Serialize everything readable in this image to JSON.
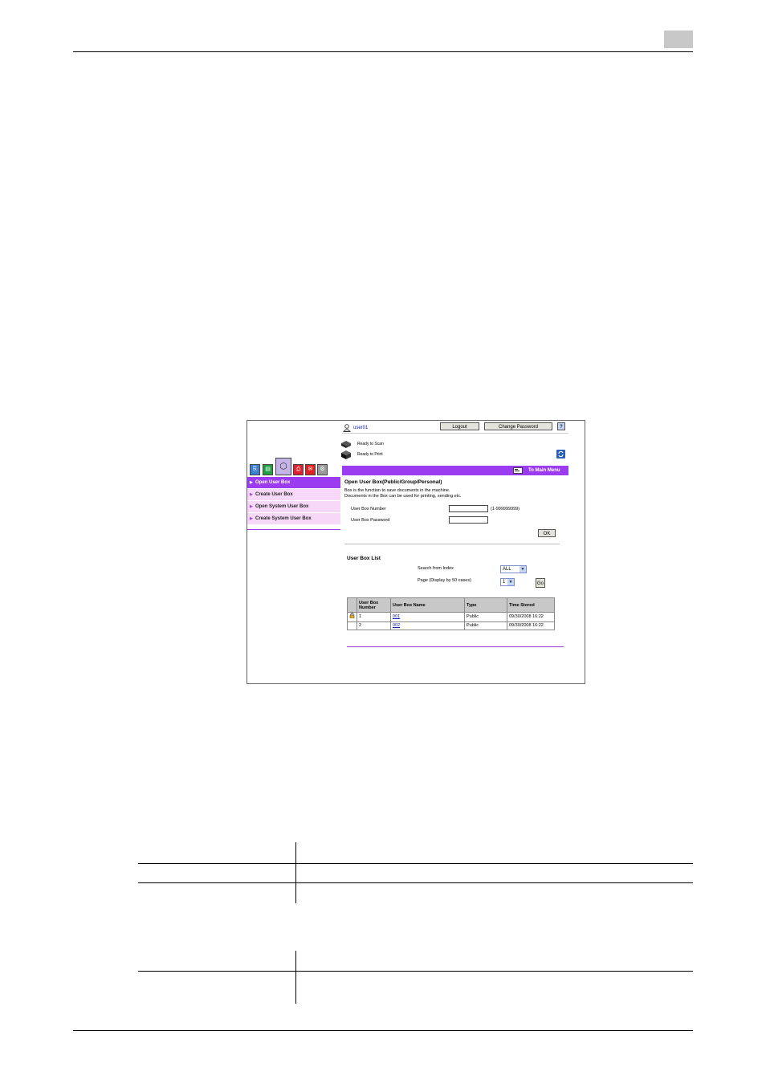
{
  "user": {
    "name": "user01"
  },
  "buttons": {
    "logout": "Logout",
    "change_password": "Change Password",
    "help": "?",
    "ok": "OK",
    "go": "Go"
  },
  "status": {
    "scan": "Ready to Scan",
    "print": "Ready to Print"
  },
  "main_menu_link": "To Main Menu",
  "menu": [
    {
      "label": "Open User Box",
      "selected": true
    },
    {
      "label": "Create User Box",
      "selected": false
    },
    {
      "label": "Open System User Box",
      "selected": false
    },
    {
      "label": "Create System User Box",
      "selected": false
    }
  ],
  "main": {
    "title": "Open User Box(Public/Group/Personal)",
    "desc_line1": "Box is the function to save documents in the machine.",
    "desc_line2": "Documents in the Box can be used for printing, sending etc.",
    "box_number_label": "User Box Number",
    "box_number_range": "(1-999999999)",
    "box_number_value": "",
    "box_password_label": "User Box Password",
    "box_password_value": ""
  },
  "list": {
    "title": "User Box List",
    "search_label": "Search from Index",
    "search_value": "ALL",
    "page_label": "Page (Display by 50 cases)",
    "page_value": "1",
    "columns": [
      "User Box Number",
      "User Box Name",
      "Type",
      "Time Stored"
    ],
    "rows": [
      {
        "locked": true,
        "number": "1",
        "name": "001",
        "type": "Public",
        "time": "09/30/2008 16:22"
      },
      {
        "locked": false,
        "number": "2",
        "name": "002",
        "type": "Public",
        "time": "09/30/2008 16:22"
      }
    ]
  },
  "colors": {
    "accent": "#9b3cf0",
    "menu_selected": "#9b3cf0",
    "menu_bg": "#f8d8f8",
    "link": "#1020c0"
  },
  "icons": [
    "user-icon",
    "help-icon",
    "scanner-icon",
    "printer-icon",
    "refresh-icon",
    "main-menu-icon",
    "lock-icon",
    "dropdown-arrow-icon"
  ]
}
